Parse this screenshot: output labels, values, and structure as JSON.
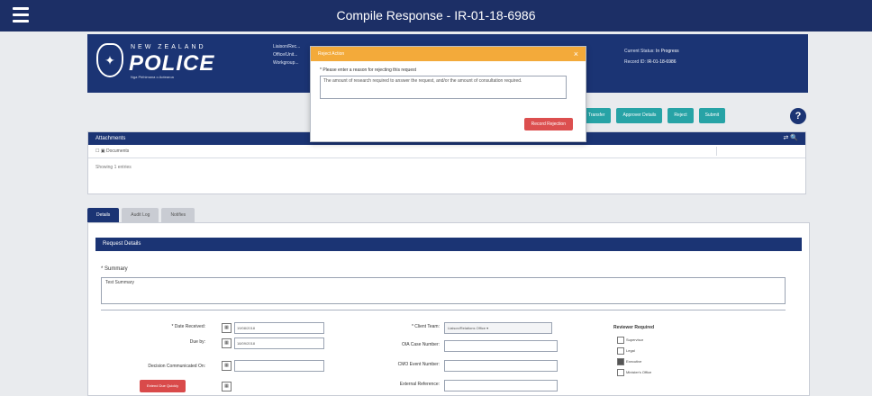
{
  "app": {
    "title": "Compile Response - IR-01-18-6986"
  },
  "header": {
    "new_zealand": "NEW ZEALAND",
    "police": "POLICE",
    "police_sub": "Nga Pirihimana o Aotearoa",
    "left_info_1": "Liaison/Rec...",
    "left_info_2": "Office/Unit...",
    "left_info_3": "Workgroup...",
    "status_label": "Current Status:",
    "status_value": "In Progress",
    "record_label": "Record ID:",
    "record_value": "IR-01-18-6986"
  },
  "actions": {
    "transfer": "Transfer",
    "approver": "Approver Details",
    "reject": "Reject",
    "submit": "Submit"
  },
  "attachments": {
    "title": "Attachments",
    "tools": "⇄ 🔍",
    "row_label": "Documents",
    "footer": "Showing 1 entries"
  },
  "tabs": [
    {
      "label": "Details"
    },
    {
      "label": "Audit Log"
    },
    {
      "label": "Notifies"
    }
  ],
  "request": {
    "section_title": "Request Details",
    "summary_label": "* Summary",
    "summary_value": "Test Summary",
    "date_received_label": "* Date Received:",
    "date_received_value": "19/08/2018",
    "due_by_label": "Due by:",
    "due_by_value": "18/09/2018",
    "decision_label": "Decision Communicated On:",
    "decision_value": "",
    "red_button": "Extend Due Quickly",
    "client_team_label": "* Client Team:",
    "client_team_value": "Liaison/Relations Office",
    "ola_label": "OIA Case Number:",
    "cmo_label": "CMO Event Number:",
    "external_label": "External Reference:",
    "reviews_title": "Reviewer Required",
    "reviews": [
      {
        "label": "Supervisor",
        "checked": false
      },
      {
        "label": "Legal",
        "checked": false
      },
      {
        "label": "Executive",
        "checked": true
      },
      {
        "label": "Minister's Office",
        "checked": false
      }
    ]
  },
  "modal": {
    "title": "Reject Action",
    "label": "* Please enter a reason for rejecting this request",
    "text": "The amount of research required to answer the request, and/or the amount of consultation required.",
    "button": "Record Rejection",
    "close": "×"
  }
}
